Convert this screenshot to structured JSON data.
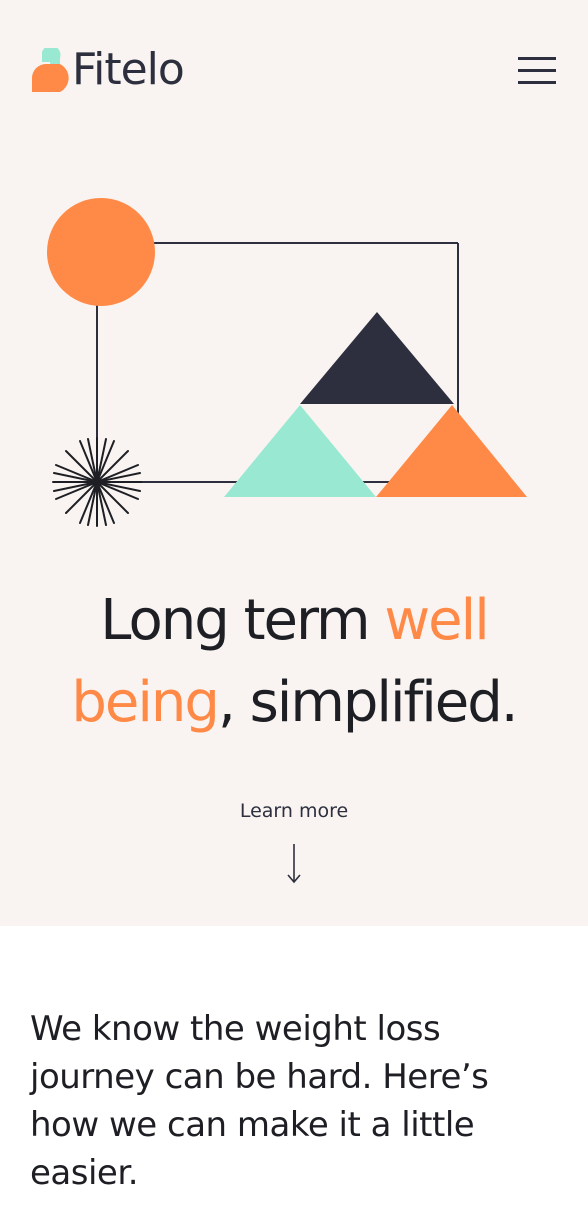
{
  "brand": {
    "name": "Fitelo",
    "logo_icon": "fitelo-logo-icon",
    "colors": {
      "orange": "#ff8a47",
      "mint": "#99e8d1",
      "navy": "#2d2f3e",
      "background": "#f9f4f1"
    }
  },
  "header": {
    "menu_icon": "hamburger-menu-icon"
  },
  "hero": {
    "headline_part1": "Long term ",
    "headline_accent1": "well",
    "headline_accent2": "being",
    "headline_part2": ", simplified.",
    "learn_more_label": "Learn more",
    "learn_more_icon": "arrow-down-icon"
  },
  "intro": {
    "text": "We know the weight loss journey can be hard. Here’s how we can make it a little easier."
  }
}
